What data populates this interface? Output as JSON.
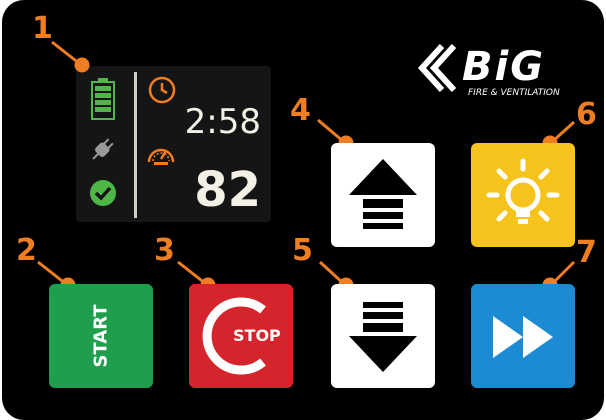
{
  "brand": {
    "name": "BiG",
    "tagline": "FIRE & VENTILATION"
  },
  "display": {
    "timer": "2:58",
    "speed": "82"
  },
  "callouts": [
    "1",
    "2",
    "3",
    "4",
    "5",
    "6",
    "7"
  ],
  "buttons": {
    "start": {
      "label": "START"
    },
    "stop": {
      "label": "STOP"
    },
    "up": {
      "icon": "up-arrow-icon"
    },
    "down": {
      "icon": "down-arrow-icon"
    },
    "light": {
      "icon": "light-bulb-icon"
    },
    "fast_forward": {
      "icon": "fast-forward-icon"
    }
  },
  "colors": {
    "accent": "#ef7d22",
    "start": "#1f9e4d",
    "stop": "#d6242c",
    "light": "#f6c21c",
    "fast_forward": "#1d8bd3",
    "status_ok": "#4fb748",
    "battery": "#4fb748"
  }
}
